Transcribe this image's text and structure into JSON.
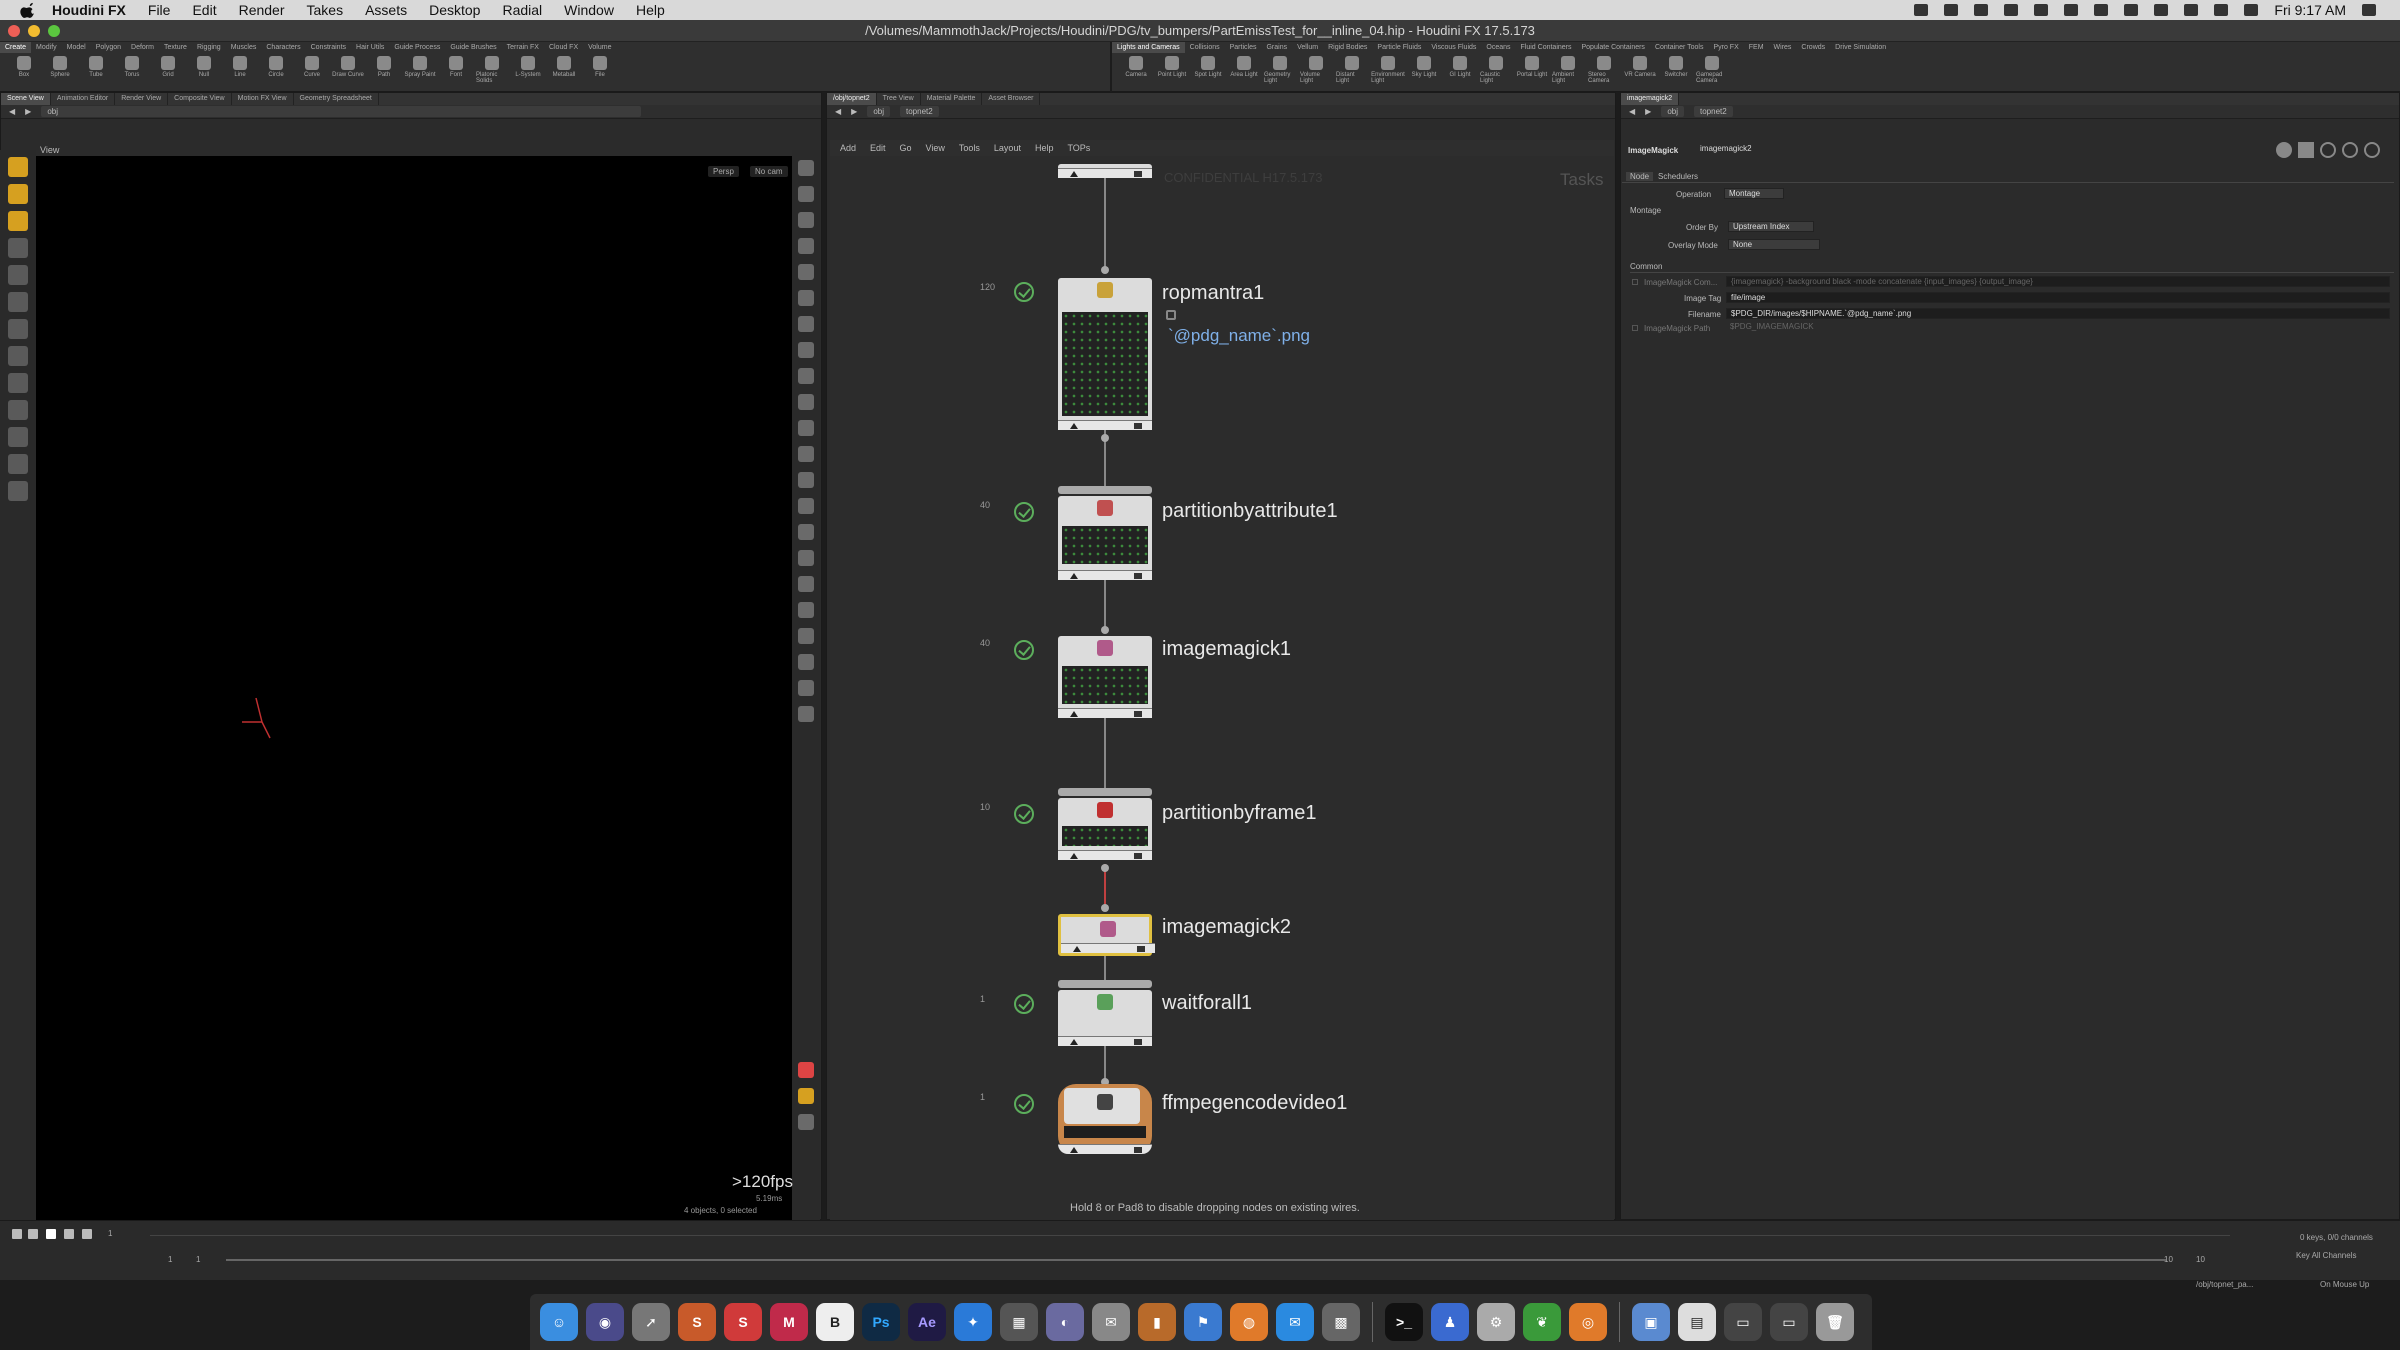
{
  "menubar": {
    "app_name": "Houdini FX",
    "items": [
      "File",
      "Edit",
      "Render",
      "Takes",
      "Assets",
      "Desktop",
      "Radial",
      "Window",
      "Help"
    ],
    "clock": "Fri 9:17 AM"
  },
  "window": {
    "title": "/Volumes/MammothJack/Projects/Houdini/PDG/tv_bumpers/PartEmissTest_for__inline_04.hip - Houdini FX 17.5.173"
  },
  "shelf_left": {
    "tabs": [
      "Create",
      "Modify",
      "Model",
      "Polygon",
      "Deform",
      "Texture",
      "Rigging",
      "Muscles",
      "Characters",
      "Constraints",
      "Hair Utils",
      "Guide Process",
      "Guide Brushes",
      "Terrain FX",
      "Cloud FX",
      "Volume"
    ],
    "tools": [
      "Box",
      "Sphere",
      "Tube",
      "Torus",
      "Grid",
      "Null",
      "Line",
      "Circle",
      "Curve",
      "Draw Curve",
      "Path",
      "Spray Paint",
      "Font",
      "Platonic Solids",
      "L-System",
      "Metaball",
      "File"
    ]
  },
  "shelf_right": {
    "tabs": [
      "Lights and Cameras",
      "Collisions",
      "Particles",
      "Grains",
      "Vellum",
      "Rigid Bodies",
      "Particle Fluids",
      "Viscous Fluids",
      "Oceans",
      "Fluid Containers",
      "Populate Containers",
      "Container Tools",
      "Pyro FX",
      "FEM",
      "Wires",
      "Crowds",
      "Drive Simulation"
    ],
    "tools": [
      "Camera",
      "Point Light",
      "Spot Light",
      "Area Light",
      "Geometry Light",
      "Volume Light",
      "Distant Light",
      "Environment Light",
      "Sky Light",
      "GI Light",
      "Caustic Light",
      "Portal Light",
      "Ambient Light",
      "Stereo Camera",
      "VR Camera",
      "Switcher",
      "Gamepad Camera"
    ]
  },
  "left_pane": {
    "tabs": [
      "Scene View",
      "Animation Editor",
      "Render View",
      "Composite View",
      "Motion FX View",
      "Geometry Spreadsheet"
    ],
    "path": "obj",
    "view_label": "View",
    "persp": "Persp",
    "cam": "No cam",
    "fps": ">120fps",
    "fps_sub": "5.19ms",
    "objinfo": "4 objects, 0 selected"
  },
  "center_pane": {
    "tabs": [
      "/obj/topnet2",
      "Tree View",
      "Material Palette",
      "Asset Browser"
    ],
    "path": [
      "obj",
      "topnet2"
    ],
    "menu": [
      "Add",
      "Edit",
      "Go",
      "View",
      "Tools",
      "Layout",
      "Help",
      "TOPs"
    ],
    "watermark": "CONFIDENTIAL H17.5.173",
    "tasks_label": "Tasks",
    "hint": "Hold 8 or Pad8 to disable dropping nodes on existing wires."
  },
  "nodes": [
    {
      "name": "ropmantra1",
      "sub": "`@pdg_name`.png",
      "count": "120"
    },
    {
      "name": "partitionbyattribute1",
      "count": "40"
    },
    {
      "name": "imagemagick1",
      "count": "40"
    },
    {
      "name": "partitionbyframe1",
      "count": "10"
    },
    {
      "name": "imagemagick2",
      "count": ""
    },
    {
      "name": "waitforall1",
      "count": "1"
    },
    {
      "name": "ffmpegencodevideo1",
      "count": "1"
    }
  ],
  "right_pane": {
    "tab": "imagemagick2",
    "path": [
      "obj",
      "topnet2"
    ],
    "node_type": "ImageMagick",
    "node_name": "imagemagick2",
    "subtabs": [
      "Node",
      "Schedulers"
    ],
    "operation_label": "Operation",
    "operation_value": "Montage",
    "section_montage": "Montage",
    "order_by_label": "Order By",
    "order_by_value": "Upstream Index",
    "overlay_label": "Overlay Mode",
    "overlay_value": "None",
    "section_common": "Common",
    "cmd_label": "ImageMagick Com...",
    "cmd_value": "{imagemagick} -background black -mode concatenate {input_images} {output_image}",
    "imagetag_label": "Image Tag",
    "imagetag_value": "file/image",
    "filename_label": "Filename",
    "filename_value": "$PDG_DIR/images/$HIPNAME.`@pdg_name`.png",
    "path_label": "ImageMagick Path",
    "path_value": "$PDG_IMAGEMAGICK"
  },
  "timeline": {
    "start": "1",
    "current": "1",
    "end_a": "10",
    "end_b": "10",
    "keys": "0 keys, 0/0 channels",
    "key_all": "Key All Channels",
    "path": "/obj/topnet_pa...",
    "update": "On Mouse Up"
  },
  "colors": {
    "accent_green": "#5cae5c",
    "wire_grey": "#888888",
    "selected_node_border": "#e0c040",
    "sub_blue": "#7fb0e8"
  }
}
